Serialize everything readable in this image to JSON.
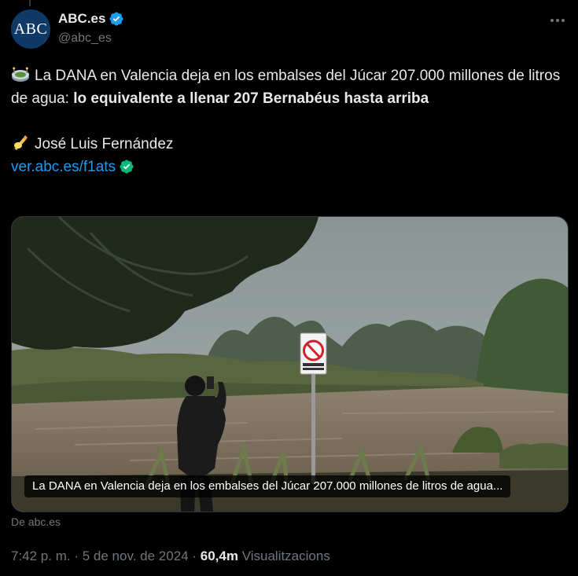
{
  "author": {
    "name": "ABC.es",
    "handle": "@abc_es",
    "avatar_text": "ABC"
  },
  "tweet": {
    "line1_emoji": "stadium-emoji",
    "line1_regular": "La DANA en Valencia deja en los embalses del Júcar 207.000 millones de litros de agua: ",
    "line1_bold": "lo equivalente a llenar 207 Bernabéus hasta arriba",
    "line2_emoji": "writing-hand-emoji",
    "author_line": "José Luis Fernández",
    "link_text": "ver.abc.es/f1ats"
  },
  "media": {
    "caption": "La DANA en Valencia deja en los embalses del Júcar 207.000 millones de litros de agua...",
    "sign_text": "PROHIBIT BANYAR-SE"
  },
  "source_text": "De abc.es",
  "meta": {
    "time": "7:42 p. m.",
    "separator": "·",
    "date": "5 de nov. de 2024",
    "views_count": "60,4m",
    "views_label": "Visualitzacions"
  },
  "colors": {
    "background": "#000000",
    "text": "#e7e9ea",
    "secondary": "#71767b",
    "link": "#1d9bf0",
    "verified": "#1d9bf0",
    "link_check": "#00ba7c",
    "avatar_bg": "#0f3966"
  }
}
